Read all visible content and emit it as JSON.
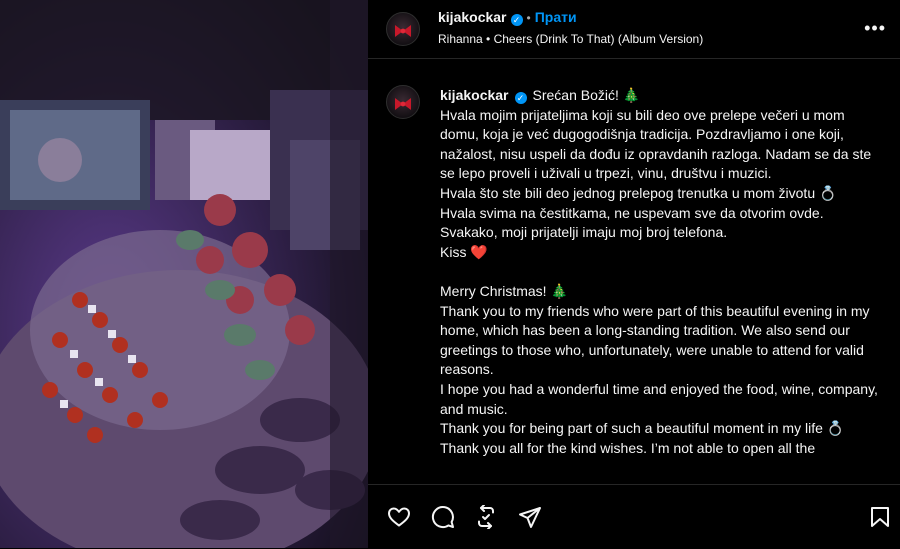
{
  "post": {
    "username": "kijakockar",
    "follow_label": "Прати",
    "separator": "•",
    "audio": "Rihanna • Cheers (Drink To That) (Album Version)",
    "more_label": "•••"
  },
  "caption": {
    "first_line": "Srećan Božić! 🎄",
    "lines": [
      "Hvala mojim prijateljima koji su bili deo ove prelepe večeri u mom domu, koja je već dugogodišnja tradicija. Pozdravljamo i one koji, nažalost, nisu uspeli da dođu iz opravdanih razloga. Nadam se da ste se lepo proveli i uživali u trpezi, vinu, društvu i muzici.",
      "Hvala što ste bili deo jednog prelepog trenutka u mom životu 💍",
      "Hvala svima na čestitkama, ne uspevam sve da otvorim ovde.",
      "Svakako, moji prijatelji imaju moj broj telefona.",
      "Kiss ❤️",
      "",
      "Merry Christmas! 🎄",
      "Thank you to my friends who were part of this beautiful evening in my home, which has been a long-standing tradition. We also send our greetings to those who, unfortunately, were unable to attend for valid reasons.",
      "I hope you had a wonderful time and enjoyed the food, wine, company, and music.",
      "Thank you for being part of such a beautiful moment in my life 💍",
      "Thank you all for the kind wishes. I’m not able to open all the"
    ]
  },
  "icons": {
    "like": "heart-icon",
    "comment": "comment-icon",
    "repost": "repost-icon",
    "share": "share-icon",
    "save": "bookmark-icon",
    "verified": "verified-badge-icon"
  },
  "colors": {
    "accent": "#0095f6",
    "background": "#000000",
    "text": "#f5f5f5"
  }
}
